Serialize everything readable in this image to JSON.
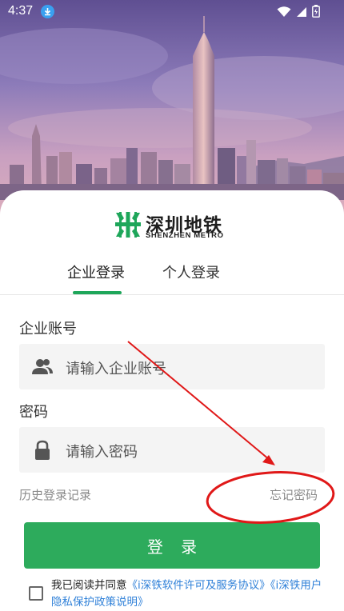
{
  "status_bar": {
    "time": "4:37"
  },
  "brand": {
    "name_cn": "深圳地铁",
    "name_en": "SHENZHEN METRO",
    "color": "#1ea65a"
  },
  "tabs": [
    {
      "label": "企业登录",
      "active": true
    },
    {
      "label": "个人登录",
      "active": false
    }
  ],
  "form": {
    "account_label": "企业账号",
    "account_placeholder": "请输入企业账号",
    "password_label": "密码",
    "password_placeholder": "请输入密码",
    "history_link": "历史登录记录",
    "forgot_link": "忘记密码",
    "login_button": "登 录"
  },
  "agreement": {
    "prefix": "我已阅读并同意",
    "link1": "《i深铁软件许可及服务协议》",
    "link2": "《i深铁用户隐私保护政策说明》",
    "checked": false
  },
  "colors": {
    "accent": "#2dab5c",
    "link": "#2f80d8",
    "annotation": "#e01818"
  }
}
